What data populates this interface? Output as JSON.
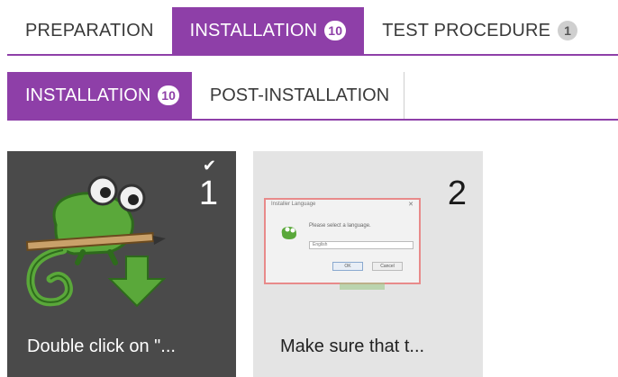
{
  "tabs": [
    {
      "label": "PREPARATION",
      "badge": ""
    },
    {
      "label": "INSTALLATION",
      "badge": "10"
    },
    {
      "label": "TEST PROCEDURE",
      "badge": "1"
    }
  ],
  "subtabs": [
    {
      "label": "INSTALLATION",
      "badge": "10"
    },
    {
      "label": "POST-INSTALLATION"
    }
  ],
  "steps": [
    {
      "number": "1",
      "caption": "Double click on \"...",
      "completed": true,
      "icon": "check-icon"
    },
    {
      "number": "2",
      "caption": "Make sure that t..."
    }
  ],
  "thumbnail": {
    "title": "Installer Language",
    "close": "✕",
    "message": "Please select a language.",
    "select_value": "English",
    "ok_label": "OK",
    "cancel_label": "Cancel"
  },
  "colors": {
    "accent": "#8e3fa8",
    "card_dark": "#4a4a4a",
    "card_light": "#e4e4e4"
  }
}
